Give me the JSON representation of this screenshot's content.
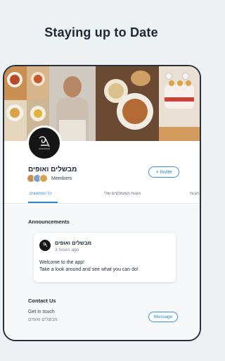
{
  "headline": "Staying up to Date",
  "group": {
    "name": "מבשלים ואופים",
    "members_label": "Members",
    "invite_label": "Invite",
    "invite_icon": "+"
  },
  "tabs": [
    {
      "label": "כל המפגשים",
      "active": true
    },
    {
      "label": "הגנות המומלצים שלי",
      "active": false
    },
    {
      "label": "חבות",
      "active": false
    }
  ],
  "announcements": {
    "title": "Announcements",
    "post": {
      "author": "מבשלים ואופים",
      "time": "3 hours ago",
      "line1": "Welcome to the app!",
      "line2": "Take a look around and see what you can do!"
    }
  },
  "contact": {
    "title": "Contact Us",
    "line1": "Get in touch",
    "line2": "מבשלים ואופים",
    "message_label": "Message"
  },
  "colors": {
    "accent": "#2b86c9",
    "logo_bg": "#161616"
  }
}
